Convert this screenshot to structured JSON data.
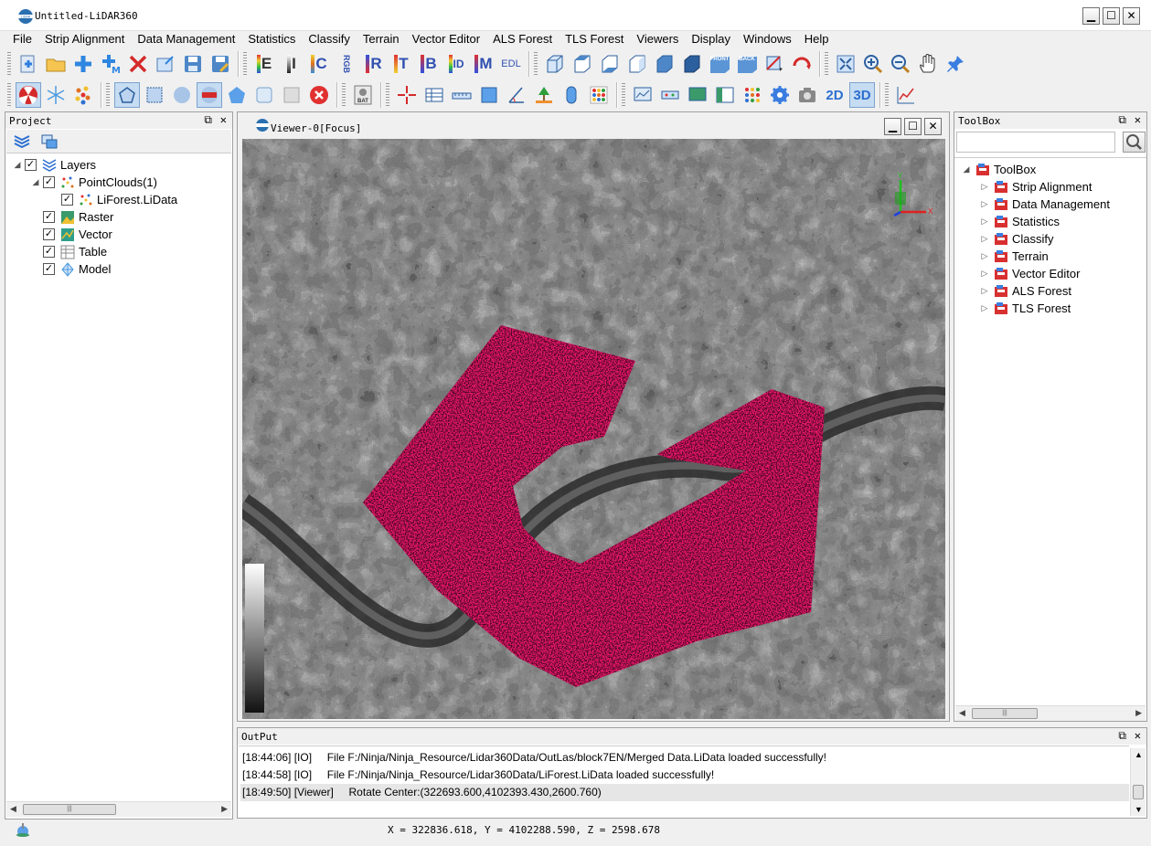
{
  "window": {
    "title": "Untitled-LiDAR360",
    "minimize": "▁",
    "maximize": "☐",
    "close": "✕"
  },
  "menu": [
    "File",
    "Strip Alignment",
    "Data Management",
    "Statistics",
    "Classify",
    "Terrain",
    "Vector Editor",
    "ALS Forest",
    "TLS Forest",
    "Viewers",
    "Display",
    "Windows",
    "Help"
  ],
  "toolbar_text_icons": {
    "e": "E",
    "i": "I",
    "c": "C",
    "rgb": "RGB",
    "r": "R",
    "t": "T",
    "b": "B",
    "id": "ID",
    "m": "M",
    "edl": "EDL",
    "front": "FRONT",
    "back": "BACK",
    "bat": "BAT",
    "two_d": "2D",
    "three_d": "3D"
  },
  "project": {
    "title": "Project",
    "tree": [
      {
        "label": "Layers",
        "level": 0,
        "checked": true,
        "expanded": true
      },
      {
        "label": "PointClouds(1)",
        "level": 1,
        "checked": true,
        "expanded": true
      },
      {
        "label": "LiForest.LiData",
        "level": 2,
        "checked": true
      },
      {
        "label": "Raster",
        "level": 1,
        "checked": true
      },
      {
        "label": "Vector",
        "level": 1,
        "checked": true
      },
      {
        "label": "Table",
        "level": 1,
        "checked": true
      },
      {
        "label": "Model",
        "level": 1,
        "checked": true
      }
    ]
  },
  "viewer": {
    "title": "Viewer-0[Focus]",
    "axis_x": "X",
    "axis_y": "Y"
  },
  "toolbox": {
    "title": "ToolBox",
    "root": "ToolBox",
    "items": [
      "Strip Alignment",
      "Data Management",
      "Statistics",
      "Classify",
      "Terrain",
      "Vector Editor",
      "ALS Forest",
      "TLS Forest"
    ]
  },
  "output": {
    "title": "OutPut",
    "lines": [
      "[18:44:06] [IO]     File F:/Ninja/Ninja_Resource/Lidar360Data/OutLas/block7EN/Merged Data.LiData loaded successfully!",
      "[18:44:58] [IO]     File F:/Ninja/Ninja_Resource/Lidar360Data/LiForest.LiData loaded successfully!",
      "[18:49:50] [Viewer]     Rotate Center:(322693.600,4102393.430,2600.760)"
    ]
  },
  "status": {
    "coords": "X = 322836.618, Y = 4102288.590, Z = 2598.678"
  },
  "colors": {
    "accent_selection": "#c5dcf2",
    "polygon": "#e8176a",
    "toolbox_icon": "#d83030"
  }
}
